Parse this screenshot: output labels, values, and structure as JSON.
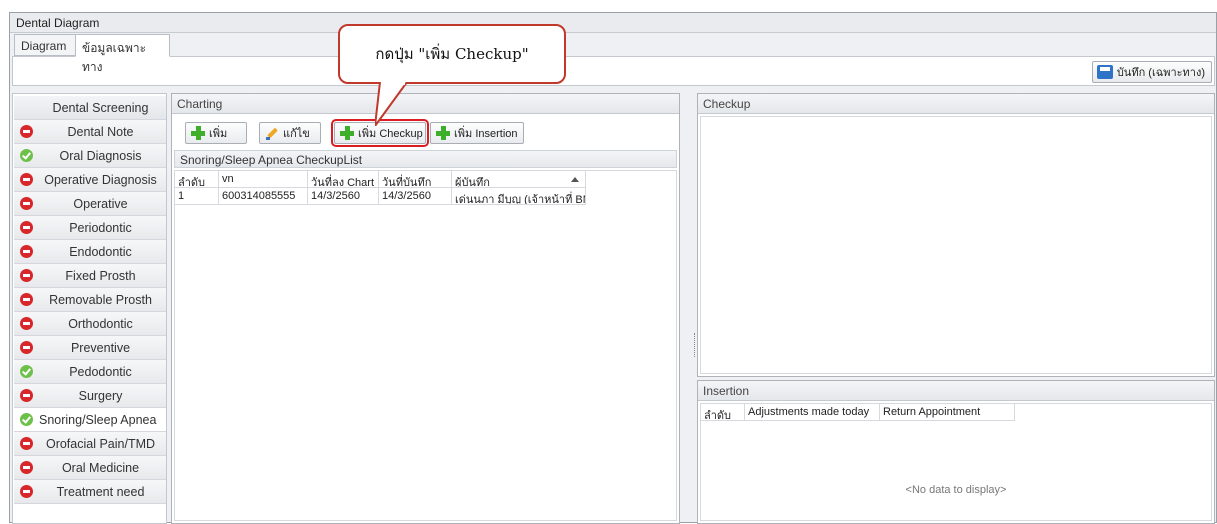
{
  "window": {
    "title": "Dental Diagram"
  },
  "tabs": [
    {
      "label": "Diagram",
      "active": false
    },
    {
      "label": "ข้อมูลเฉพาะทาง",
      "active": true
    }
  ],
  "toolbar": {
    "save_label": "บันทึก (เฉพาะทาง)",
    "save_icon": "floppy-disk-icon"
  },
  "callout": {
    "text": "กดปุ่ม \"เพิ่ม Checkup\""
  },
  "nav": {
    "items": [
      {
        "label": "Dental Screening",
        "status": "none"
      },
      {
        "label": "Dental Note",
        "status": "red"
      },
      {
        "label": "Oral Diagnosis",
        "status": "green"
      },
      {
        "label": "Operative Diagnosis",
        "status": "red"
      },
      {
        "label": "Operative",
        "status": "red"
      },
      {
        "label": "Periodontic",
        "status": "red"
      },
      {
        "label": "Endodontic",
        "status": "red"
      },
      {
        "label": "Fixed Prosth",
        "status": "red"
      },
      {
        "label": "Removable Prosth",
        "status": "red"
      },
      {
        "label": "Orthodontic",
        "status": "red"
      },
      {
        "label": "Preventive",
        "status": "red"
      },
      {
        "label": "Pedodontic",
        "status": "green"
      },
      {
        "label": "Surgery",
        "status": "red"
      },
      {
        "label": "Snoring/Sleep Apnea",
        "status": "green",
        "active": true
      },
      {
        "label": "Orofacial Pain/TMD",
        "status": "red"
      },
      {
        "label": "Oral Medicine",
        "status": "red"
      },
      {
        "label": "Treatment need",
        "status": "red"
      }
    ]
  },
  "charting": {
    "header": "Charting",
    "buttons": {
      "add": "เพิ่ม",
      "edit": "แก้ไข",
      "add_checkup": "เพิ่ม Checkup",
      "add_insertion": "เพิ่ม Insertion"
    },
    "list_title": "Snoring/Sleep Apnea CheckupList",
    "columns": [
      "ลำดับ",
      "vn",
      "วันที่ลง Chart",
      "วันที่บันทึก",
      "ผู้บันทึก"
    ],
    "rows": [
      [
        "1",
        "600314085555",
        "14/3/2560",
        "14/3/2560",
        "เด่นนภา มีบุญ (เจ้าหน้าที่ BMS"
      ]
    ]
  },
  "checkup": {
    "header": "Checkup"
  },
  "insertion": {
    "header": "Insertion",
    "columns": [
      "ลำดับ",
      "Adjustments made today",
      "Return Appointment"
    ],
    "empty_text": "<No data to display>"
  },
  "colors": {
    "accent_red": "#d81e24",
    "status_red": "#d8262a",
    "status_green": "#6fc04a",
    "plus_green": "#3fae2a"
  }
}
